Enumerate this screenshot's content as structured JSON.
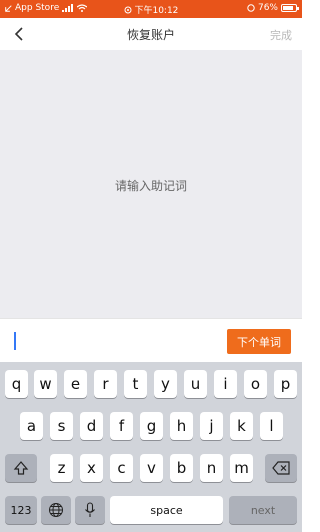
{
  "status_bar": {
    "carrier": "App Store",
    "time": "下午10:12",
    "battery": "76%",
    "background": "#e8541a"
  },
  "nav": {
    "back_icon": "chevron-left-icon",
    "title": "恢复账户",
    "done_label": "完成"
  },
  "content": {
    "hint": "请输入助记词"
  },
  "input_bar": {
    "value": "",
    "next_label": "下个单词",
    "accent": "#ef6c1c"
  },
  "keyboard": {
    "row1": [
      "q",
      "w",
      "e",
      "r",
      "t",
      "y",
      "u",
      "i",
      "o",
      "p"
    ],
    "row2": [
      "a",
      "s",
      "d",
      "f",
      "g",
      "h",
      "j",
      "k",
      "l"
    ],
    "row3": [
      "z",
      "x",
      "c",
      "v",
      "b",
      "n",
      "m"
    ],
    "numbers_label": "123",
    "space_label": "space",
    "next_key_label": "next",
    "shift_icon": "shift-icon",
    "delete_icon": "backspace-icon",
    "globe_icon": "globe-icon",
    "mic_icon": "microphone-icon"
  }
}
